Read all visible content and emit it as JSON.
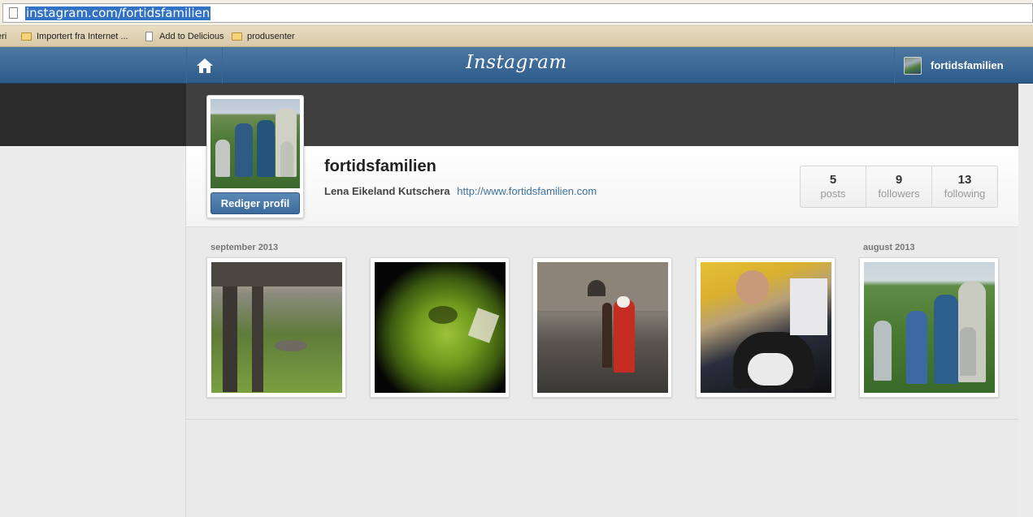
{
  "browser": {
    "url": "instagram.com/fortidsfamilien",
    "bookmarks": [
      {
        "label": "eri",
        "icon": "folder-icon"
      },
      {
        "label": "Importert fra Internet ...",
        "icon": "folder-icon"
      },
      {
        "label": "Add to Delicious",
        "icon": "page-icon"
      },
      {
        "label": "produsenter",
        "icon": "folder-icon"
      }
    ]
  },
  "nav": {
    "logo": "Instagram",
    "username": "fortidsfamilien",
    "home_icon": "home-icon"
  },
  "profile": {
    "username": "fortidsfamilien",
    "full_name": "Lena Eikeland Kutschera",
    "website": "http://www.fortidsfamilien.com",
    "edit_button": "Rediger profil",
    "stats": [
      {
        "value": "5",
        "label": "posts"
      },
      {
        "value": "9",
        "label": "followers"
      },
      {
        "value": "13",
        "label": "following"
      }
    ]
  },
  "feed": {
    "date_labels": [
      "september 2013",
      "august 2013"
    ],
    "photos": [
      {
        "name": "photo-cloister-ruins"
      },
      {
        "name": "photo-green-jug"
      },
      {
        "name": "photo-medieval-costumes"
      },
      {
        "name": "photo-man-with-cat"
      },
      {
        "name": "photo-family-portrait"
      }
    ]
  },
  "colors": {
    "nav_blue": "#2d5b8a",
    "link_blue": "#3f729b",
    "button_blue": "#3c6b9b"
  }
}
